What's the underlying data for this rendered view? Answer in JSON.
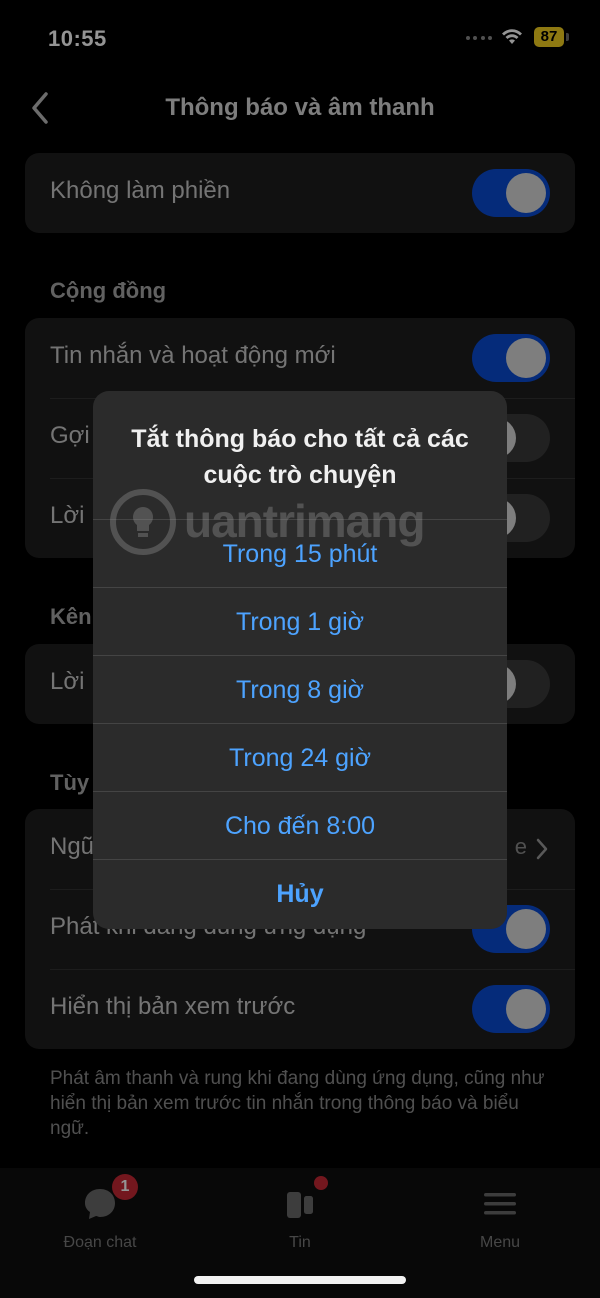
{
  "status_bar": {
    "time": "10:55",
    "battery": "87"
  },
  "nav": {
    "title": "Thông báo và âm thanh"
  },
  "groups": {
    "dnd": {
      "label": "Không làm phiền",
      "on": true
    },
    "community": {
      "header": "Cộng đồng",
      "rows": [
        {
          "label": "Tin nhắn và hoạt động mới",
          "on": true
        },
        {
          "label": "Gợi",
          "on": false
        },
        {
          "label": "Lời",
          "on": false
        }
      ]
    },
    "channel": {
      "header": "Kên",
      "rows": [
        {
          "label": "Lời",
          "on": false
        }
      ]
    },
    "custom": {
      "header": "Tùy",
      "rows": [
        {
          "label": "Ngũ",
          "value": "e"
        },
        {
          "label": "Phát khi đang dùng ứng dụng",
          "on": true
        },
        {
          "label": "Hiển thị bản xem trước",
          "on": true
        }
      ]
    },
    "footnote": "Phát âm thanh và rung khi đang dùng ứng dụng, cũng như hiển thị bản xem trước tin nhắn trong thông báo và biểu ngữ."
  },
  "sheet": {
    "title": "Tắt thông báo cho tất cả các cuộc trò chuyện",
    "options": [
      "Trong 15 phút",
      "Trong 1 giờ",
      "Trong 8 giờ",
      "Trong 24 giờ",
      "Cho đến 8:00"
    ],
    "cancel": "Hủy"
  },
  "tabbar": {
    "tabs": [
      {
        "label": "Đoạn chat",
        "icon": "chat-bubble-icon",
        "badge": "1"
      },
      {
        "label": "Tin",
        "icon": "stories-icon"
      },
      {
        "label": "Menu",
        "icon": "hamburger-menu-icon"
      }
    ]
  },
  "watermark": {
    "text": "uantrimang"
  },
  "colors": {
    "accent": "#4da3ff",
    "toggle_on": "#0a4bd3",
    "badge": "#c62834",
    "battery": "#f5d020"
  }
}
